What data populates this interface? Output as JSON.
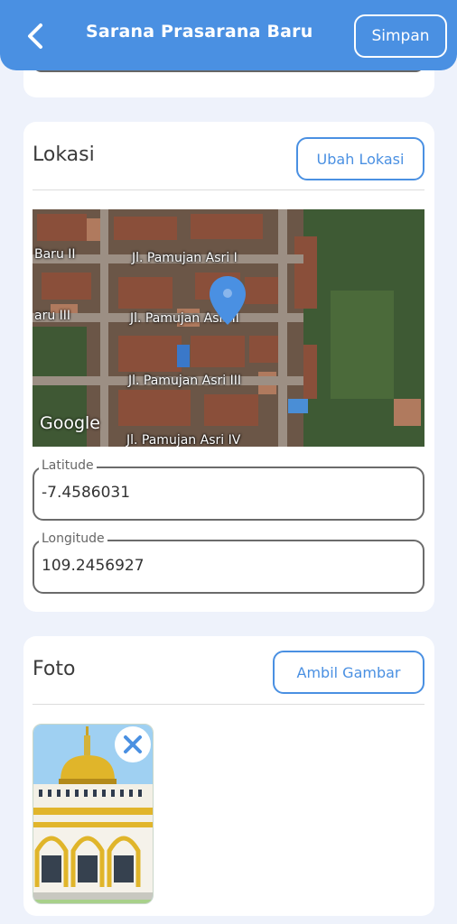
{
  "header": {
    "title": "Sarana Prasarana Baru",
    "save_label": "Simpan",
    "color": "#4a90e2"
  },
  "lokasi": {
    "title": "Lokasi",
    "change_button": "Ubah Lokasi",
    "map": {
      "streets": [
        "Baru II",
        "Jl. Pamujan Asri I",
        "aru III",
        "Jl. Pamujan Asri II",
        "Jl. Pamujan Asri III",
        "Jl. Pamujan Asri IV"
      ],
      "brand": "Google",
      "pin_icon": "location-pin-icon"
    },
    "latitude": {
      "label": "Latitude",
      "value": "-7.4586031"
    },
    "longitude": {
      "label": "Longitude",
      "value": "109.2456927"
    }
  },
  "foto": {
    "title": "Foto",
    "take_button": "Ambil Gambar",
    "remove_icon": "close-icon",
    "photo_icon": "mosque-image"
  }
}
